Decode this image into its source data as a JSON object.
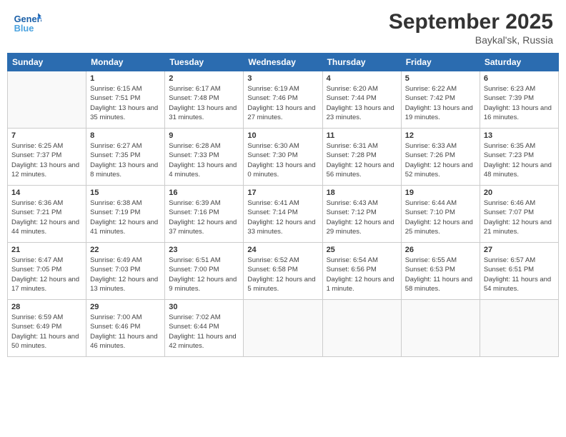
{
  "header": {
    "logo_line1": "General",
    "logo_line2": "Blue",
    "month_year": "September 2025",
    "location": "Baykal'sk, Russia"
  },
  "weekdays": [
    "Sunday",
    "Monday",
    "Tuesday",
    "Wednesday",
    "Thursday",
    "Friday",
    "Saturday"
  ],
  "weeks": [
    [
      {
        "day": "",
        "sunrise": "",
        "sunset": "",
        "daylight": ""
      },
      {
        "day": "1",
        "sunrise": "Sunrise: 6:15 AM",
        "sunset": "Sunset: 7:51 PM",
        "daylight": "Daylight: 13 hours and 35 minutes."
      },
      {
        "day": "2",
        "sunrise": "Sunrise: 6:17 AM",
        "sunset": "Sunset: 7:48 PM",
        "daylight": "Daylight: 13 hours and 31 minutes."
      },
      {
        "day": "3",
        "sunrise": "Sunrise: 6:19 AM",
        "sunset": "Sunset: 7:46 PM",
        "daylight": "Daylight: 13 hours and 27 minutes."
      },
      {
        "day": "4",
        "sunrise": "Sunrise: 6:20 AM",
        "sunset": "Sunset: 7:44 PM",
        "daylight": "Daylight: 13 hours and 23 minutes."
      },
      {
        "day": "5",
        "sunrise": "Sunrise: 6:22 AM",
        "sunset": "Sunset: 7:42 PM",
        "daylight": "Daylight: 13 hours and 19 minutes."
      },
      {
        "day": "6",
        "sunrise": "Sunrise: 6:23 AM",
        "sunset": "Sunset: 7:39 PM",
        "daylight": "Daylight: 13 hours and 16 minutes."
      }
    ],
    [
      {
        "day": "7",
        "sunrise": "Sunrise: 6:25 AM",
        "sunset": "Sunset: 7:37 PM",
        "daylight": "Daylight: 13 hours and 12 minutes."
      },
      {
        "day": "8",
        "sunrise": "Sunrise: 6:27 AM",
        "sunset": "Sunset: 7:35 PM",
        "daylight": "Daylight: 13 hours and 8 minutes."
      },
      {
        "day": "9",
        "sunrise": "Sunrise: 6:28 AM",
        "sunset": "Sunset: 7:33 PM",
        "daylight": "Daylight: 13 hours and 4 minutes."
      },
      {
        "day": "10",
        "sunrise": "Sunrise: 6:30 AM",
        "sunset": "Sunset: 7:30 PM",
        "daylight": "Daylight: 13 hours and 0 minutes."
      },
      {
        "day": "11",
        "sunrise": "Sunrise: 6:31 AM",
        "sunset": "Sunset: 7:28 PM",
        "daylight": "Daylight: 12 hours and 56 minutes."
      },
      {
        "day": "12",
        "sunrise": "Sunrise: 6:33 AM",
        "sunset": "Sunset: 7:26 PM",
        "daylight": "Daylight: 12 hours and 52 minutes."
      },
      {
        "day": "13",
        "sunrise": "Sunrise: 6:35 AM",
        "sunset": "Sunset: 7:23 PM",
        "daylight": "Daylight: 12 hours and 48 minutes."
      }
    ],
    [
      {
        "day": "14",
        "sunrise": "Sunrise: 6:36 AM",
        "sunset": "Sunset: 7:21 PM",
        "daylight": "Daylight: 12 hours and 44 minutes."
      },
      {
        "day": "15",
        "sunrise": "Sunrise: 6:38 AM",
        "sunset": "Sunset: 7:19 PM",
        "daylight": "Daylight: 12 hours and 41 minutes."
      },
      {
        "day": "16",
        "sunrise": "Sunrise: 6:39 AM",
        "sunset": "Sunset: 7:16 PM",
        "daylight": "Daylight: 12 hours and 37 minutes."
      },
      {
        "day": "17",
        "sunrise": "Sunrise: 6:41 AM",
        "sunset": "Sunset: 7:14 PM",
        "daylight": "Daylight: 12 hours and 33 minutes."
      },
      {
        "day": "18",
        "sunrise": "Sunrise: 6:43 AM",
        "sunset": "Sunset: 7:12 PM",
        "daylight": "Daylight: 12 hours and 29 minutes."
      },
      {
        "day": "19",
        "sunrise": "Sunrise: 6:44 AM",
        "sunset": "Sunset: 7:10 PM",
        "daylight": "Daylight: 12 hours and 25 minutes."
      },
      {
        "day": "20",
        "sunrise": "Sunrise: 6:46 AM",
        "sunset": "Sunset: 7:07 PM",
        "daylight": "Daylight: 12 hours and 21 minutes."
      }
    ],
    [
      {
        "day": "21",
        "sunrise": "Sunrise: 6:47 AM",
        "sunset": "Sunset: 7:05 PM",
        "daylight": "Daylight: 12 hours and 17 minutes."
      },
      {
        "day": "22",
        "sunrise": "Sunrise: 6:49 AM",
        "sunset": "Sunset: 7:03 PM",
        "daylight": "Daylight: 12 hours and 13 minutes."
      },
      {
        "day": "23",
        "sunrise": "Sunrise: 6:51 AM",
        "sunset": "Sunset: 7:00 PM",
        "daylight": "Daylight: 12 hours and 9 minutes."
      },
      {
        "day": "24",
        "sunrise": "Sunrise: 6:52 AM",
        "sunset": "Sunset: 6:58 PM",
        "daylight": "Daylight: 12 hours and 5 minutes."
      },
      {
        "day": "25",
        "sunrise": "Sunrise: 6:54 AM",
        "sunset": "Sunset: 6:56 PM",
        "daylight": "Daylight: 12 hours and 1 minute."
      },
      {
        "day": "26",
        "sunrise": "Sunrise: 6:55 AM",
        "sunset": "Sunset: 6:53 PM",
        "daylight": "Daylight: 11 hours and 58 minutes."
      },
      {
        "day": "27",
        "sunrise": "Sunrise: 6:57 AM",
        "sunset": "Sunset: 6:51 PM",
        "daylight": "Daylight: 11 hours and 54 minutes."
      }
    ],
    [
      {
        "day": "28",
        "sunrise": "Sunrise: 6:59 AM",
        "sunset": "Sunset: 6:49 PM",
        "daylight": "Daylight: 11 hours and 50 minutes."
      },
      {
        "day": "29",
        "sunrise": "Sunrise: 7:00 AM",
        "sunset": "Sunset: 6:46 PM",
        "daylight": "Daylight: 11 hours and 46 minutes."
      },
      {
        "day": "30",
        "sunrise": "Sunrise: 7:02 AM",
        "sunset": "Sunset: 6:44 PM",
        "daylight": "Daylight: 11 hours and 42 minutes."
      },
      {
        "day": "",
        "sunrise": "",
        "sunset": "",
        "daylight": ""
      },
      {
        "day": "",
        "sunrise": "",
        "sunset": "",
        "daylight": ""
      },
      {
        "day": "",
        "sunrise": "",
        "sunset": "",
        "daylight": ""
      },
      {
        "day": "",
        "sunrise": "",
        "sunset": "",
        "daylight": ""
      }
    ]
  ]
}
